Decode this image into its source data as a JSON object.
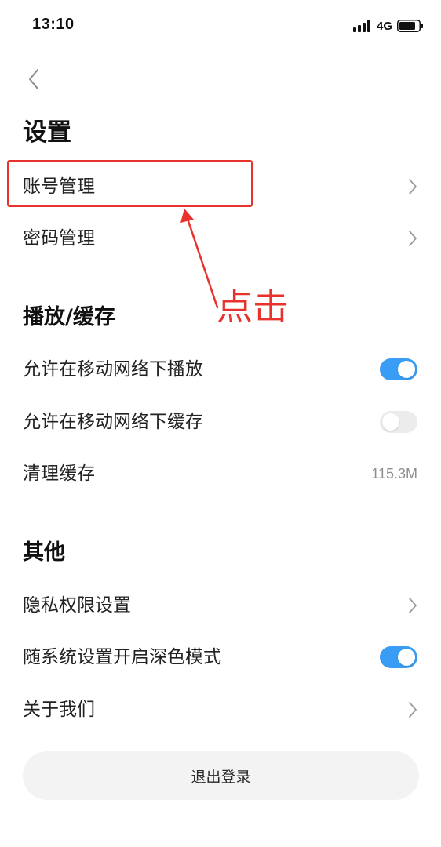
{
  "status_bar": {
    "time": "13:10",
    "network": "4G",
    "icons": [
      "signal-icon",
      "battery-icon"
    ]
  },
  "header": {
    "back_icon": "chevron-left-icon",
    "title": "设置"
  },
  "account_section": {
    "items": [
      {
        "label": "账号管理",
        "control": "chevron-right-icon"
      },
      {
        "label": "密码管理",
        "control": "chevron-right-icon"
      }
    ]
  },
  "playback_section": {
    "title": "播放/缓存",
    "items": [
      {
        "label": "允许在移动网络下播放",
        "control": "toggle",
        "toggle_on": true
      },
      {
        "label": "允许在移动网络下缓存",
        "control": "toggle",
        "toggle_on": false
      },
      {
        "label": "清理缓存",
        "value": "115.3M"
      }
    ]
  },
  "other_section": {
    "title": "其他",
    "items": [
      {
        "label": "隐私权限设置",
        "control": "chevron-right-icon"
      },
      {
        "label": "随系统设置开启深色模式",
        "control": "toggle",
        "toggle_on": true
      },
      {
        "label": "关于我们",
        "control": "chevron-right-icon"
      }
    ]
  },
  "logout": {
    "label": "退出登录"
  },
  "annotation": {
    "text": "点击",
    "color": "#e8322d"
  },
  "colors": {
    "toggle_on": "#3a9df5",
    "toggle_off": "#ececec",
    "chevron": "#9b9b9b",
    "button_bg": "#f3f3f3",
    "annotation": "#e8322d"
  }
}
